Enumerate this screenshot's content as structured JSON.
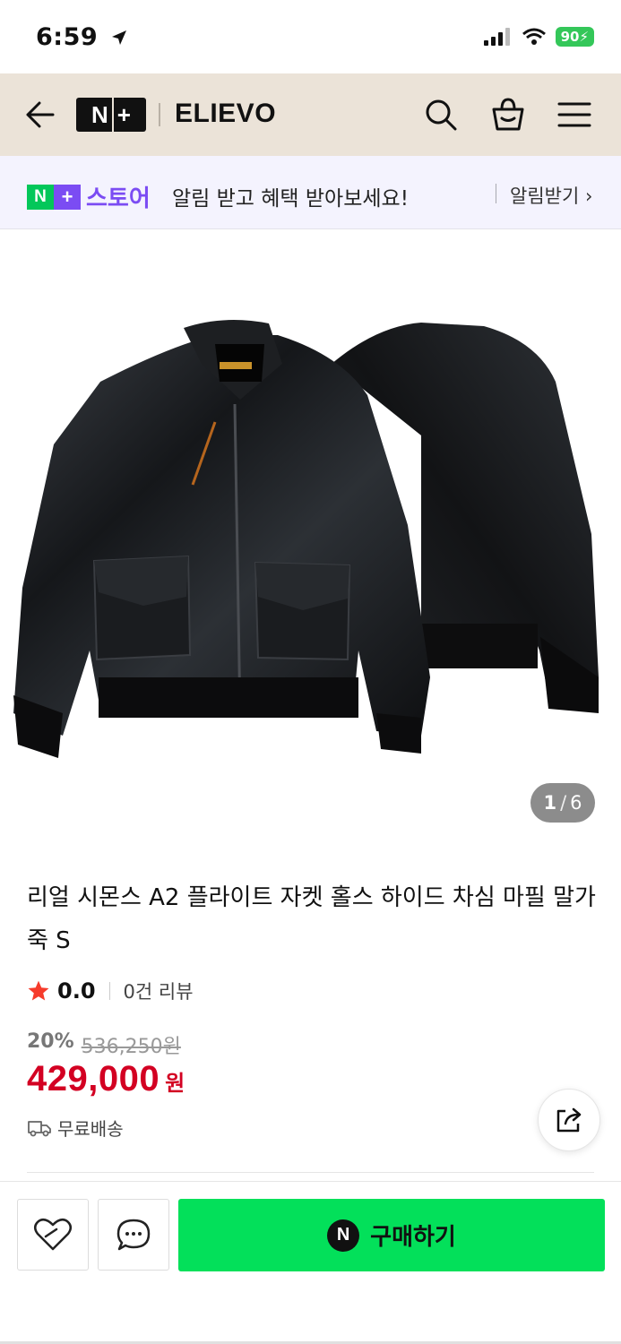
{
  "status_bar": {
    "time": "6:59",
    "battery": "90"
  },
  "header": {
    "logo": "N+",
    "shop_name": "ELIEVO"
  },
  "notice": {
    "logo_n": "N",
    "logo_plus": "+",
    "logo_text": "스토어",
    "text": "알림 받고 혜택 받아보세요!",
    "action": "알림받기 ›"
  },
  "gallery": {
    "current": "1",
    "separator": "/",
    "total": "6"
  },
  "product": {
    "title": "리얼 시몬스 A2 플라이트 자켓 홀스 하이드 차심 마필 말가죽 S",
    "rating": "0.0",
    "reviews": "0건 리뷰",
    "discount": "20%",
    "original_price": "536,250원",
    "price": "429,000",
    "price_unit": "원",
    "shipping": "무료배송"
  },
  "actions": {
    "buy_label": "구매하기",
    "buy_badge": "N"
  },
  "colors": {
    "accent_green": "#03e05a",
    "price_red": "#d30022",
    "store_purple": "#7b4cf3",
    "header_bg": "#ebe3d8"
  }
}
